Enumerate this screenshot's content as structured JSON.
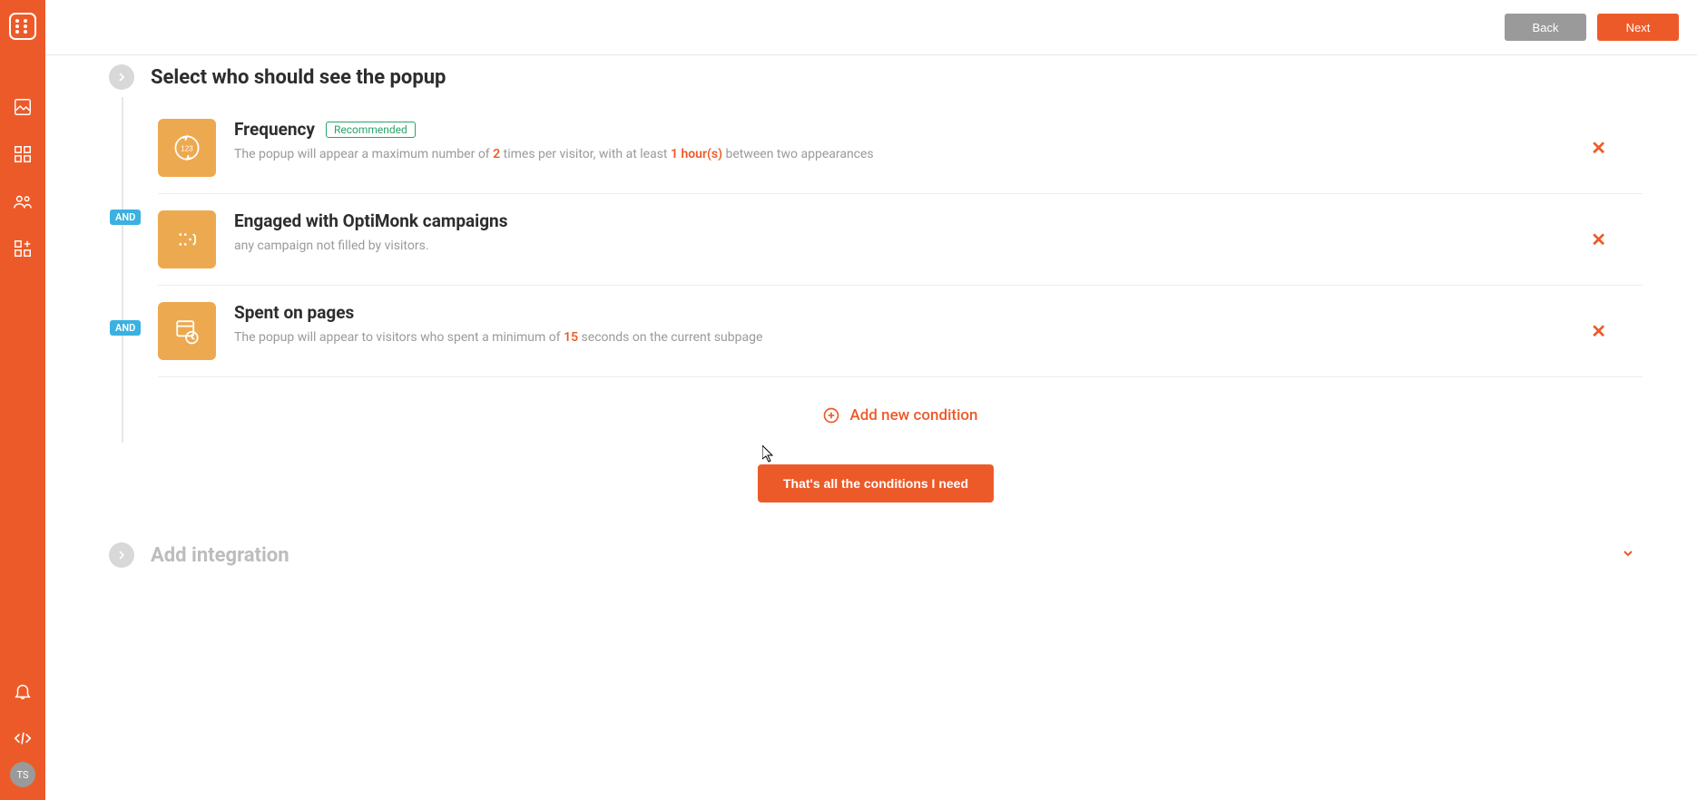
{
  "topbar": {
    "back": "Back",
    "next": "Next"
  },
  "avatar": "TS",
  "section": {
    "title": "Select who should see the popup"
  },
  "and_label": "AND",
  "badge_recommended": "Recommended",
  "conditions": [
    {
      "title": "Frequency",
      "recommended": true,
      "desc_pre": "The popup will appear a maximum number of ",
      "desc_v1": "2",
      "desc_mid": " times per visitor, with at least ",
      "desc_v2": "1 hour(s)",
      "desc_post": " between two appearances"
    },
    {
      "title": "Engaged with OptiMonk campaigns",
      "recommended": false,
      "desc_pre": "any campaign not filled by visitors.",
      "desc_v1": "",
      "desc_mid": "",
      "desc_v2": "",
      "desc_post": ""
    },
    {
      "title": "Spent on pages",
      "recommended": false,
      "desc_pre": "The popup will appear to visitors who spent a minimum of ",
      "desc_v1": "15",
      "desc_mid": " seconds on the current subpage",
      "desc_v2": "",
      "desc_post": ""
    }
  ],
  "add_condition": "Add new condition",
  "done": "That's all the conditions I need",
  "integration": {
    "title": "Add integration"
  }
}
